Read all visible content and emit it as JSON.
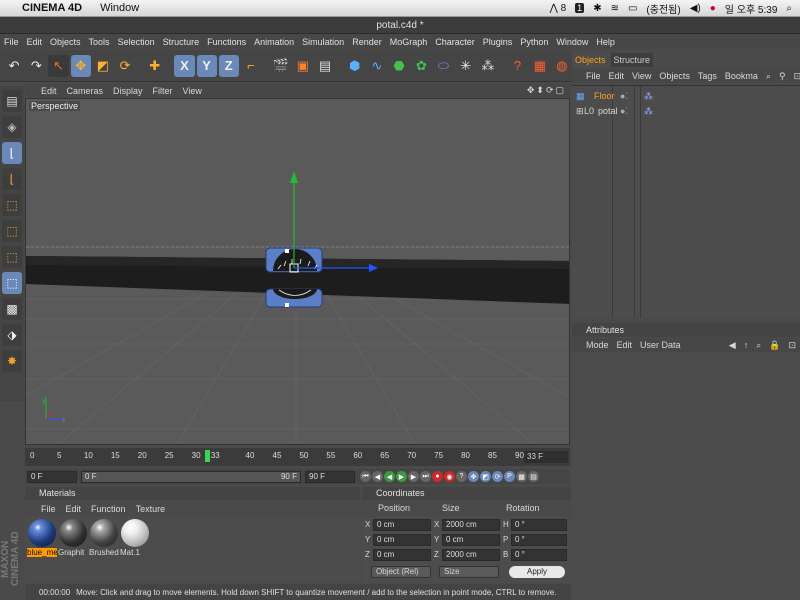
{
  "macbar": {
    "app_name": "CINEMA 4D",
    "menus": [
      "Window"
    ],
    "indicator_a": "8",
    "indicator_b": "1",
    "battery_label": "(충전됨)",
    "clock": "일 오후 5:39"
  },
  "window": {
    "title": "potal.c4d *"
  },
  "app_menu": [
    "File",
    "Edit",
    "Objects",
    "Tools",
    "Selection",
    "Structure",
    "Functions",
    "Animation",
    "Simulation",
    "Render",
    "MoGraph",
    "Character",
    "Plugins",
    "Python",
    "Window",
    "Help"
  ],
  "toolbar": {
    "axis_x": "X",
    "axis_y": "Y",
    "axis_z": "Z"
  },
  "viewport": {
    "menu": [
      "Edit",
      "Cameras",
      "Display",
      "Filter",
      "View"
    ],
    "label": "Perspective",
    "nav_icons": "✥⬍⟳▢",
    "axis_y": "y",
    "axis_z": "z"
  },
  "object_manager": {
    "tabs": [
      "Objects",
      "Structure"
    ],
    "menu": [
      "File",
      "Edit",
      "View",
      "Objects",
      "Tags",
      "Bookma"
    ],
    "objects": [
      {
        "name": "Floor",
        "selected": true
      },
      {
        "name": "potal",
        "selected": false
      }
    ],
    "colors": {
      "selected_text": "#ffa020"
    }
  },
  "attributes": {
    "title": "Attributes",
    "menu": [
      "Mode",
      "Edit",
      "User Data"
    ]
  },
  "timeline": {
    "ticks": [
      "0",
      "5",
      "10",
      "15",
      "20",
      "25",
      "30",
      "33",
      "40",
      "45",
      "50",
      "55",
      "60",
      "65",
      "70",
      "75",
      "80",
      "85",
      "90"
    ],
    "current_frame": 33,
    "max_frame": 90,
    "current_marker": "33",
    "frame_field": "33 F"
  },
  "playbar": {
    "start": "0 F",
    "range_start": "0 F",
    "range_end": "90 F",
    "end": "90 F"
  },
  "materials": {
    "title": "Materials",
    "menu": [
      "File",
      "Edit",
      "Function",
      "Texture"
    ],
    "items": [
      {
        "name": "blue_me",
        "selected": true,
        "color": "#2b4a8a"
      },
      {
        "name": "Graphit",
        "selected": false,
        "color": "#555555"
      },
      {
        "name": "Brushed",
        "selected": false,
        "color": "#666666"
      },
      {
        "name": "Mat.1",
        "selected": false,
        "color": "#cccccc"
      }
    ]
  },
  "coordinates": {
    "title": "Coordinates",
    "col_position": "Position",
    "col_size": "Size",
    "col_rotation": "Rotation",
    "rows": [
      {
        "axis": "X",
        "pos": "0 cm",
        "size_axis": "X",
        "size": "2000 cm",
        "rot_axis": "H",
        "rot": "0 °"
      },
      {
        "axis": "Y",
        "pos": "0 cm",
        "size_axis": "Y",
        "size": "0 cm",
        "rot_axis": "P",
        "rot": "0 °"
      },
      {
        "axis": "Z",
        "pos": "0 cm",
        "size_axis": "Z",
        "size": "2000 cm",
        "rot_axis": "B",
        "rot": "0 °"
      }
    ],
    "mode_dropdown": "Object (Rel)",
    "size_dropdown": "Size",
    "apply": "Apply"
  },
  "status": {
    "time": "00:00:00",
    "message": "Move: Click and drag to move elements. Hold down SHIFT to quantize movement / add to the selection in point mode, CTRL to remove."
  },
  "logo": {
    "text": "MAXON CINEMA 4D"
  },
  "colors": {
    "accent": "#6a88b8",
    "playhead": "#39d452",
    "axis_x": "#2255ff",
    "axis_y": "#22bb33"
  }
}
